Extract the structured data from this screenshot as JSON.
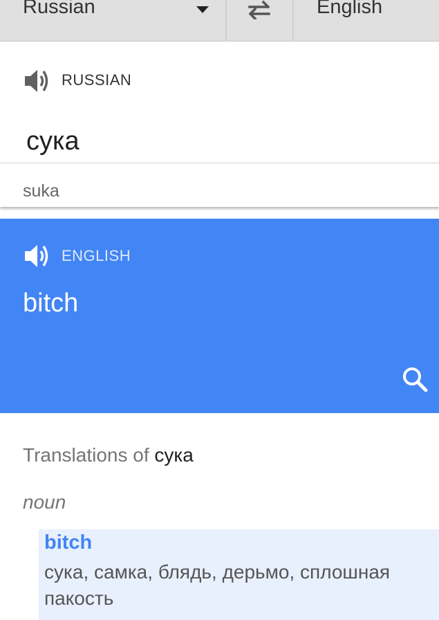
{
  "header": {
    "source_language": "Russian",
    "target_language": "English",
    "swap_icon": "swap-arrows-icon",
    "dropdown_icon": "caret-down-icon"
  },
  "source": {
    "language_label": "RUSSIAN",
    "text": "сука",
    "transliteration": "suka",
    "speaker_icon": "speaker-icon"
  },
  "result": {
    "language_label": "ENGLISH",
    "text": "bitch",
    "speaker_icon": "speaker-icon",
    "search_icon": "search-icon",
    "background_color": "#4285f4"
  },
  "dictionary": {
    "title_prefix": "Translations of",
    "title_term": "сука",
    "part_of_speech": "noun",
    "entries": [
      {
        "word": "bitch",
        "synonyms": "сука, самка, блядь, дерьмо, сплошная пакость"
      }
    ]
  }
}
